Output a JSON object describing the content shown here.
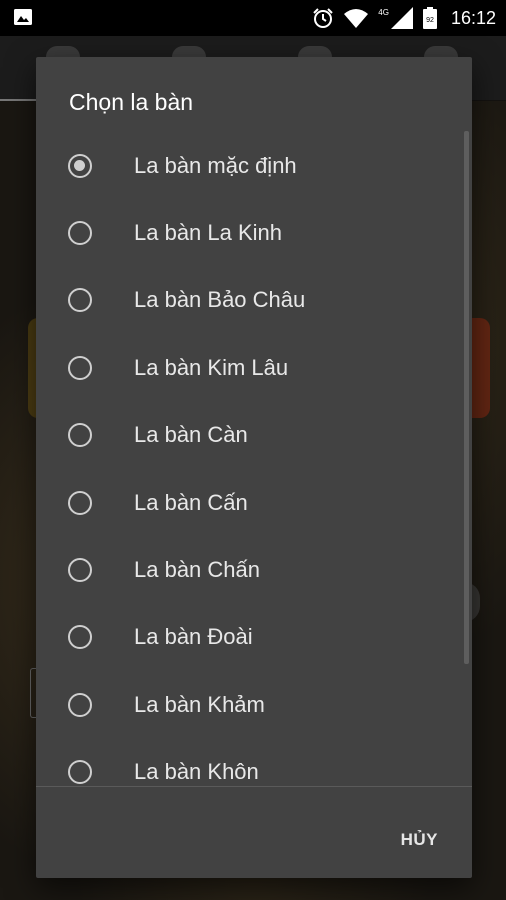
{
  "status_bar": {
    "time": "16:12",
    "battery_level": "92",
    "network": "4G",
    "icons": [
      "image-icon",
      "alarm-icon",
      "wifi-icon",
      "cellular-signal-icon",
      "battery-icon"
    ]
  },
  "dialog": {
    "title": "Chọn la bàn",
    "options": [
      {
        "label": "La bàn mặc định",
        "checked": true
      },
      {
        "label": "La bàn La Kinh",
        "checked": false
      },
      {
        "label": "La bàn Bảo Châu",
        "checked": false
      },
      {
        "label": "La bàn Kim Lâu",
        "checked": false
      },
      {
        "label": "La bàn Càn",
        "checked": false
      },
      {
        "label": "La bàn Cấn",
        "checked": false
      },
      {
        "label": "La bàn Chấn",
        "checked": false
      },
      {
        "label": "La bàn Đoài",
        "checked": false
      },
      {
        "label": "La bàn Khảm",
        "checked": false
      },
      {
        "label": "La bàn Khôn",
        "checked": false
      }
    ],
    "cancel_label": "HỦY"
  },
  "colors": {
    "dialog_bg": "#424242",
    "text": "#e8e8e8",
    "radio": "#cfcfcf"
  }
}
